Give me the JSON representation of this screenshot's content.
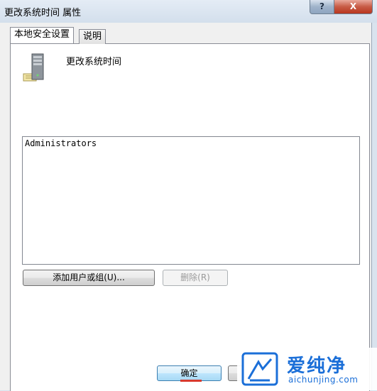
{
  "window": {
    "title": "更改系统时间 属性",
    "help_label": "?",
    "close_label": "X"
  },
  "tabs": [
    {
      "label": "本地安全设置",
      "active": true
    },
    {
      "label": "说明",
      "active": false
    }
  ],
  "policy": {
    "name": "更改系统时间",
    "icon": "server-icon"
  },
  "members": [
    "Administrators"
  ],
  "buttons": {
    "add": "添加用户或组(U)...",
    "remove": "删除(R)",
    "ok": "确定"
  },
  "watermark": {
    "brand": "爱纯净",
    "url": "aichunjing.com"
  }
}
